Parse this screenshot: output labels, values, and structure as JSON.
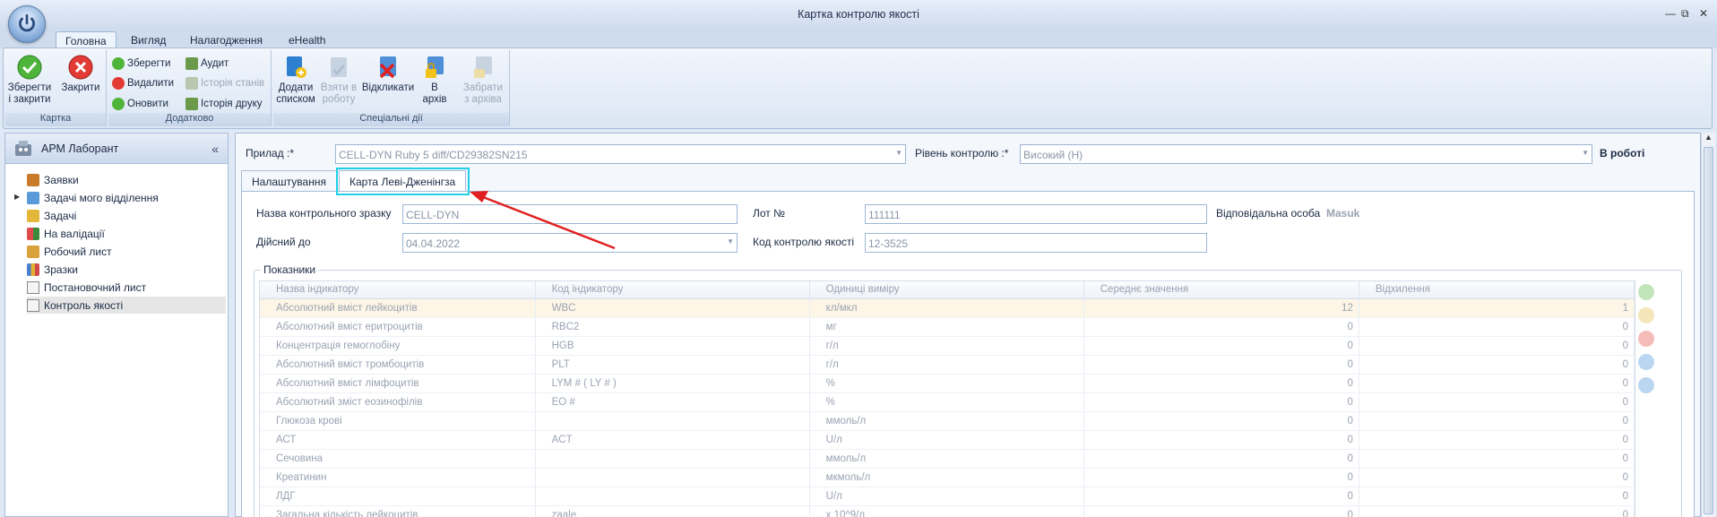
{
  "window": {
    "title": "Картка контролю якості",
    "controls": [
      "—",
      "⧉",
      "✕"
    ]
  },
  "ribbon_tabs": [
    {
      "label": "Головна",
      "active": true
    },
    {
      "label": "Вигляд"
    },
    {
      "label": "Налагодження"
    },
    {
      "label": "eHealth"
    }
  ],
  "ribbon": {
    "groups": {
      "kartka": "Картка",
      "dodatkovo": "Додатково",
      "special": "Спеціальні дії"
    },
    "save_close": [
      "Зберегти",
      "і закрити"
    ],
    "close": "Закрити",
    "save": "Зберегти",
    "delete": "Видалити",
    "refresh": "Оновити",
    "audit": "Аудит",
    "state_history": "Історія станів",
    "print_history": "Історія друку",
    "add_list": [
      "Додати",
      "списком"
    ],
    "take_work": [
      "Взяти в",
      "роботу"
    ],
    "revoke": "Відкликати",
    "archive": [
      "В",
      "архів"
    ],
    "from_archive": [
      "Забрати",
      "з архіва"
    ]
  },
  "left_panel": {
    "title": "АРМ Лаборант",
    "collapse": "«",
    "items": [
      {
        "label": "Заявки"
      },
      {
        "label": "Задачі мого відділення"
      },
      {
        "label": "Задачі",
        "expandable": true
      },
      {
        "label": "На валідації"
      },
      {
        "label": "Робочий лист"
      },
      {
        "label": "Зразки"
      },
      {
        "label": "Постановочний лист"
      },
      {
        "label": "Контроль якості",
        "selected": true
      }
    ]
  },
  "form": {
    "device_label": "Прилад :*",
    "device_value": "CELL-DYN Ruby 5 diff/CD29382SN215",
    "level_label": "Рівень контролю :*",
    "level_value": "Високий (H)",
    "status": "В роботі",
    "tabs": [
      "Налаштування",
      "Карта Леві-Дженінгза"
    ],
    "sample_name_label": "Назва контрольного зразку",
    "sample_name_value": "CELL-DYN",
    "lot_label": "Лот №",
    "lot_value": "111111",
    "responsible_label": "Відповідальна особа",
    "responsible_value": "Masuk",
    "valid_until_label": "Дійсний до",
    "valid_until_value": "04.04.2022",
    "qc_code_label": "Код контролю якості",
    "qc_code_value": "12-3525",
    "indicators_group": "Показники"
  },
  "grid": {
    "columns": [
      "Назва індикатору",
      "Код індикатору",
      "Одиниці виміру",
      "Середнє значення",
      "Відхилення"
    ],
    "rows": [
      [
        "Абсолютний вміст лейкоцитів",
        "WBC",
        "кл/мкл",
        "12",
        "1"
      ],
      [
        "Абсолютний вміст еритроцитів",
        "RBC2",
        "мг",
        "0",
        "0"
      ],
      [
        "Концентрація гемоглобіну",
        "HGB",
        "г/л",
        "0",
        "0"
      ],
      [
        "Абсолютний вміст тромбоцитів",
        "PLT",
        "г/л",
        "0",
        "0"
      ],
      [
        "Абсолютний вміст лімфоцитів",
        "LYM # ( LY # )",
        "%",
        "0",
        "0"
      ],
      [
        "Абсолютний зміст еозинофілів",
        "EO #",
        "%",
        "0",
        "0"
      ],
      [
        "Глюкоза крові",
        "",
        "ммоль/л",
        "0",
        "0"
      ],
      [
        "АСТ",
        "ACT",
        "U/л",
        "0",
        "0"
      ],
      [
        "Сечовина",
        "",
        "ммоль/л",
        "0",
        "0"
      ],
      [
        "Креатинин",
        "",
        "мкмоль/л",
        "0",
        "0"
      ],
      [
        "ЛДГ",
        "",
        "U/л",
        "0",
        "0"
      ],
      [
        "Загальна кількість лейкоцитів",
        "zaale",
        "х 10^9/л",
        "0",
        "0"
      ]
    ]
  },
  "colors": {
    "highlight": "#1fd0e8",
    "arrow": "#e02020"
  }
}
